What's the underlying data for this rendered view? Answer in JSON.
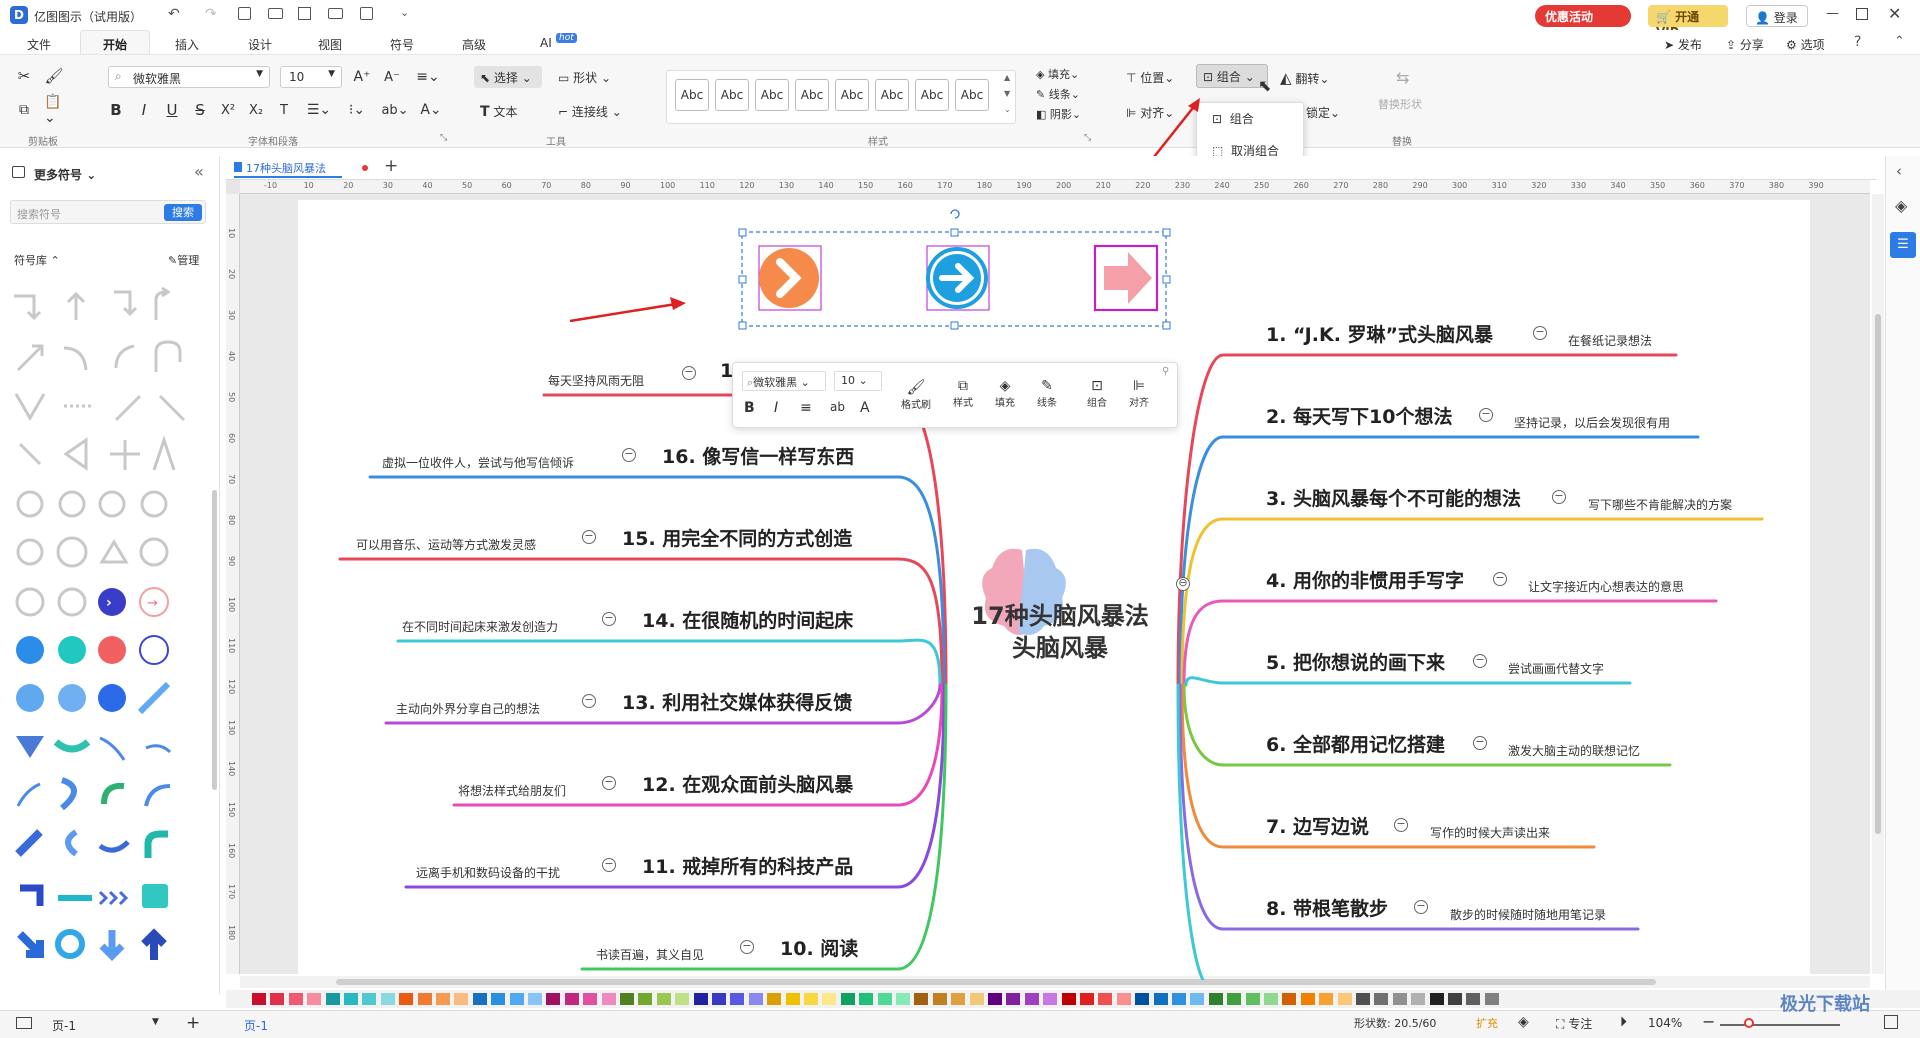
{
  "app": {
    "title": "亿图图示（试用版）",
    "promo": "优惠活动",
    "vip": "开通VIP",
    "login": "登录"
  },
  "menu_tabs": [
    "文件",
    "开始",
    "插入",
    "设计",
    "视图",
    "符号",
    "高级",
    "AI"
  ],
  "ai_badge": "hot",
  "top_right": {
    "publish": "发布",
    "share": "分享",
    "options": "选项"
  },
  "ribbon": {
    "font_name": "微软雅黑",
    "font_size": "10",
    "group_clipboard": "剪贴板",
    "group_font": "字体和段落",
    "group_tools": "工具",
    "group_style": "样式",
    "group_replace": "替换",
    "select": "选择",
    "shape": "形状",
    "text": "文本",
    "connector": "连接线",
    "style_labels": [
      "Abc",
      "Abc",
      "Abc",
      "Abc",
      "Abc",
      "Abc",
      "Abc",
      "Abc"
    ],
    "fill": "填充",
    "line": "线条",
    "shadow": "阴影",
    "position": "位置",
    "group": "组合",
    "flip": "翻转",
    "align": "对齐",
    "lock": "锁定",
    "replace_shape": "替换形状"
  },
  "group_dropdown": {
    "items": [
      "组合",
      "取消组合"
    ]
  },
  "left_panel": {
    "title": "更多符号",
    "search_placeholder": "搜索符号",
    "search_btn": "搜索",
    "library": "符号库",
    "manage": "管理"
  },
  "doc_tab": "17种头脑风暴法",
  "ruler_h": [
    "-10",
    "10",
    "20",
    "30",
    "40",
    "50",
    "60",
    "70",
    "80",
    "90",
    "100",
    "110",
    "120",
    "130",
    "140",
    "150",
    "160",
    "170",
    "180",
    "190",
    "200",
    "210",
    "220",
    "230",
    "240",
    "250",
    "260",
    "270",
    "280",
    "290",
    "300",
    "310",
    "320",
    "330",
    "340",
    "350",
    "360",
    "370",
    "380",
    "390"
  ],
  "ruler_v": [
    "10",
    "20",
    "30",
    "40",
    "50",
    "60",
    "70",
    "80",
    "90",
    "100",
    "110",
    "120",
    "130",
    "140",
    "150",
    "160",
    "170",
    "180"
  ],
  "mindmap": {
    "center": [
      "17种头脑风暴法",
      "头脑风暴"
    ],
    "right": [
      {
        "title": "1.  “J.K. 罗琳”式头脑风暴",
        "note": "在餐纸记录想法",
        "color": "#e8475a"
      },
      {
        "title": "2. 每天写下10个想法",
        "note": "坚持记录，以后会发现很有用",
        "color": "#3a8ee0"
      },
      {
        "title": "3. 头脑风暴每个不可能的想法",
        "note": "写下哪些不肯能解决的方案",
        "color": "#f0c030"
      },
      {
        "title": "4. 用你的非惯用手写字",
        "note": "让文字接近内心想表达的意思",
        "color": "#e85ab8"
      },
      {
        "title": "5. 把你想说的画下来",
        "note": "尝试画画代替文字",
        "color": "#3cc8d8"
      },
      {
        "title": "6. 全部都用记忆搭建",
        "note": "激发大脑主动的联想记忆",
        "color": "#78c840"
      },
      {
        "title": "7. 边写边说",
        "note": "写作的时候大声读出来",
        "color": "#f08a3a"
      },
      {
        "title": "8. 带根笔散步",
        "note": "散步的时候随时随地用笔记录",
        "color": "#8a6ae0"
      }
    ],
    "left": [
      {
        "title": "1",
        "note": "每天坚持风雨无阻",
        "color": "#e8475a"
      },
      {
        "title": "16. 像写信一样写东西",
        "note": "虚拟一位收件人，尝试与他写信倾诉",
        "color": "#3a8ee0"
      },
      {
        "title": "15. 用完全不同的方式创造",
        "note": "可以用音乐、运动等方式激发灵感",
        "color": "#e8475a"
      },
      {
        "title": "14. 在很随机的时间起床",
        "note": "在不同时间起床来激发创造力",
        "color": "#3cc8d8"
      },
      {
        "title": "13. 利用社交媒体获得反馈",
        "note": "主动向外界分享自己的想法",
        "color": "#b84ad8"
      },
      {
        "title": "12. 在观众面前头脑风暴",
        "note": "将想法样式给朋友们",
        "color": "#e84ab8"
      },
      {
        "title": "11. 戒掉所有的科技产品",
        "note": "远离手机和数码设备的干扰",
        "color": "#8a4ae0"
      },
      {
        "title": "10. 阅读",
        "note": "书读百遍，其义自见",
        "color": "#40c860"
      }
    ]
  },
  "floating_toolbar": {
    "font": "微软雅黑",
    "size": "10",
    "format_brush": "格式刷",
    "style": "样式",
    "fill": "填充",
    "line": "线条",
    "group": "组合",
    "align": "对齐"
  },
  "status": {
    "page": "页-1",
    "page_tab": "页-1",
    "shape_count": "形状数: 20.5/60",
    "expand": "扩充",
    "focus": "专注",
    "zoom": "104%"
  },
  "watermark": "极光下载站"
}
